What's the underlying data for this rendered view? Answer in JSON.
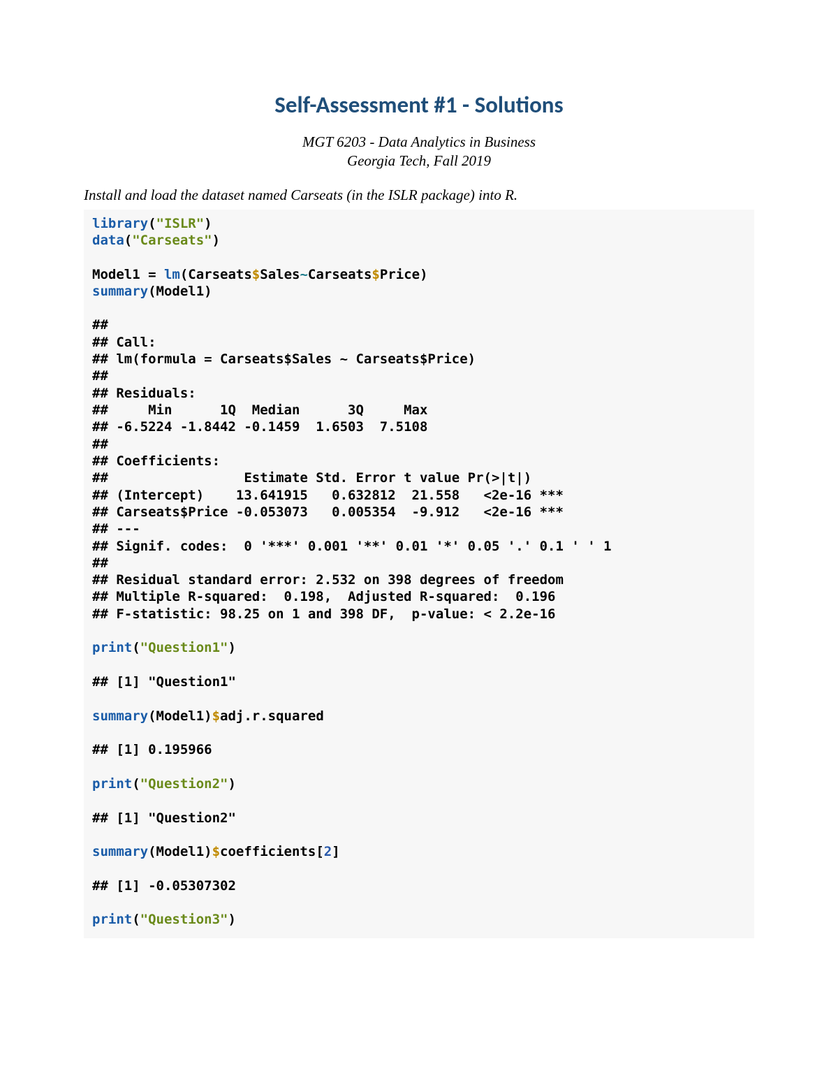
{
  "title": "Self-Assessment #1 - Solutions",
  "course_line": "MGT 6203 - Data Analytics in Business",
  "school_line": "Georgia Tech, Fall 2019",
  "instruction": "Install and load the dataset named Carseats (in the ISLR package) into R.",
  "code": {
    "library": "library",
    "paren_open": "(",
    "paren_close": ")",
    "islr_str": "\"ISLR\"",
    "data": "data",
    "carseats_str": "\"Carseats\"",
    "model1_assign": "Model1 = ",
    "lm": "lm",
    "lm_arg_pre": "(Carseats",
    "dollar1": "$",
    "sales": "Sales",
    "tilde": "~",
    "carseats2": "Carseats",
    "dollar2": "$",
    "price": "Price)",
    "summary": "summary",
    "summary_arg": "(Model1)",
    "out_block1_l1": "##",
    "out_block1_l2": "## Call:",
    "out_block1_l3": "## lm(formula = Carseats$Sales ~ Carseats$Price)",
    "out_block1_l4": "##",
    "out_block1_l5": "## Residuals:",
    "out_block1_l6": "##     Min      1Q  Median      3Q     Max ",
    "out_block1_l7": "## -6.5224 -1.8442 -0.1459  1.6503  7.5108 ",
    "out_block1_l8": "##",
    "out_block1_l9": "## Coefficients:",
    "out_block1_l10": "##                 Estimate Std. Error t value Pr(>|t|)    ",
    "out_block1_l11": "## (Intercept)    13.641915   0.632812  21.558   <2e-16 ***",
    "out_block1_l12": "## Carseats$Price -0.053073   0.005354  -9.912   <2e-16 ***",
    "out_block1_l13": "## ---",
    "out_block1_l14": "## Signif. codes:  0 '***' 0.001 '**' 0.01 '*' 0.05 '.' 0.1 ' ' 1",
    "out_block1_l15": "##",
    "out_block1_l16": "## Residual standard error: 2.532 on 398 degrees of freedom",
    "out_block1_l17": "## Multiple R-squared:  0.198,\tAdjusted R-squared:  0.196 ",
    "out_block1_l18": "## F-statistic: 98.25 on 1 and 398 DF,  p-value: < 2.2e-16",
    "print": "print",
    "q1_str": "\"Question1\"",
    "out_q1": "## [1] \"Question1\"",
    "summary2": "summary",
    "summary2_arg": "(Model1)",
    "dollar3": "$",
    "adj_r": "adj.r.squared",
    "out_adj": "## [1] 0.195966",
    "q2_str": "\"Question2\"",
    "out_q2": "## [1] \"Question2\"",
    "summary3": "summary",
    "summary3_arg": "(Model1)",
    "dollar4": "$",
    "coef": "coefficients[",
    "two": "2",
    "bracket_close": "]",
    "out_coef": "## [1] -0.05307302",
    "q3_str": "\"Question3\""
  }
}
